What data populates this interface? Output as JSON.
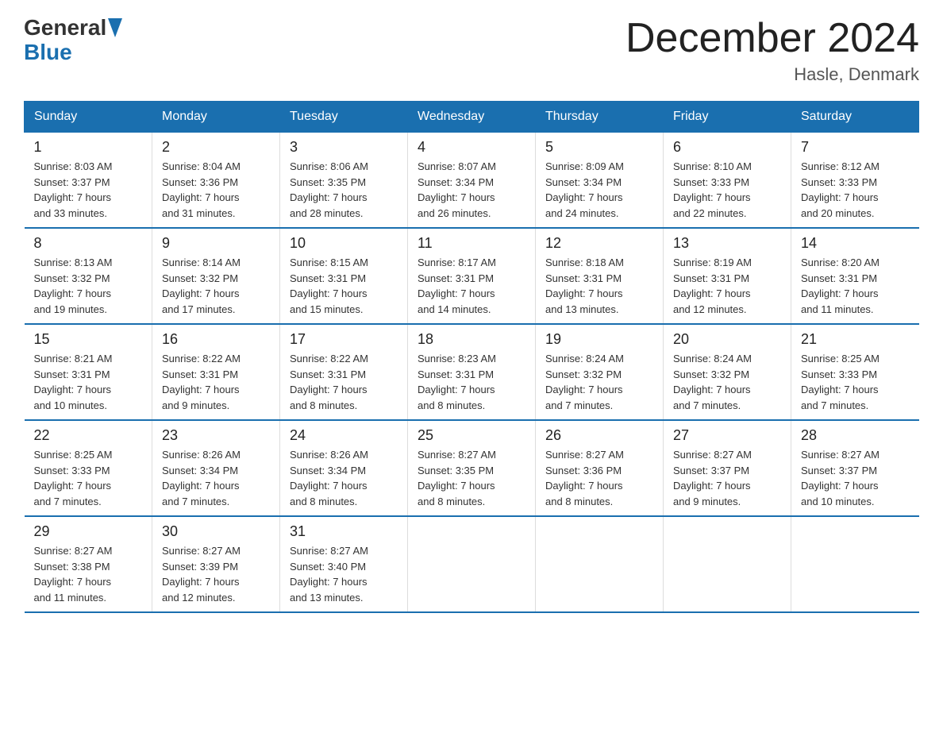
{
  "logo": {
    "general": "General",
    "blue": "Blue"
  },
  "title": {
    "month_year": "December 2024",
    "location": "Hasle, Denmark"
  },
  "days_of_week": [
    "Sunday",
    "Monday",
    "Tuesday",
    "Wednesday",
    "Thursday",
    "Friday",
    "Saturday"
  ],
  "weeks": [
    [
      {
        "day": "1",
        "info": "Sunrise: 8:03 AM\nSunset: 3:37 PM\nDaylight: 7 hours\nand 33 minutes."
      },
      {
        "day": "2",
        "info": "Sunrise: 8:04 AM\nSunset: 3:36 PM\nDaylight: 7 hours\nand 31 minutes."
      },
      {
        "day": "3",
        "info": "Sunrise: 8:06 AM\nSunset: 3:35 PM\nDaylight: 7 hours\nand 28 minutes."
      },
      {
        "day": "4",
        "info": "Sunrise: 8:07 AM\nSunset: 3:34 PM\nDaylight: 7 hours\nand 26 minutes."
      },
      {
        "day": "5",
        "info": "Sunrise: 8:09 AM\nSunset: 3:34 PM\nDaylight: 7 hours\nand 24 minutes."
      },
      {
        "day": "6",
        "info": "Sunrise: 8:10 AM\nSunset: 3:33 PM\nDaylight: 7 hours\nand 22 minutes."
      },
      {
        "day": "7",
        "info": "Sunrise: 8:12 AM\nSunset: 3:33 PM\nDaylight: 7 hours\nand 20 minutes."
      }
    ],
    [
      {
        "day": "8",
        "info": "Sunrise: 8:13 AM\nSunset: 3:32 PM\nDaylight: 7 hours\nand 19 minutes."
      },
      {
        "day": "9",
        "info": "Sunrise: 8:14 AM\nSunset: 3:32 PM\nDaylight: 7 hours\nand 17 minutes."
      },
      {
        "day": "10",
        "info": "Sunrise: 8:15 AM\nSunset: 3:31 PM\nDaylight: 7 hours\nand 15 minutes."
      },
      {
        "day": "11",
        "info": "Sunrise: 8:17 AM\nSunset: 3:31 PM\nDaylight: 7 hours\nand 14 minutes."
      },
      {
        "day": "12",
        "info": "Sunrise: 8:18 AM\nSunset: 3:31 PM\nDaylight: 7 hours\nand 13 minutes."
      },
      {
        "day": "13",
        "info": "Sunrise: 8:19 AM\nSunset: 3:31 PM\nDaylight: 7 hours\nand 12 minutes."
      },
      {
        "day": "14",
        "info": "Sunrise: 8:20 AM\nSunset: 3:31 PM\nDaylight: 7 hours\nand 11 minutes."
      }
    ],
    [
      {
        "day": "15",
        "info": "Sunrise: 8:21 AM\nSunset: 3:31 PM\nDaylight: 7 hours\nand 10 minutes."
      },
      {
        "day": "16",
        "info": "Sunrise: 8:22 AM\nSunset: 3:31 PM\nDaylight: 7 hours\nand 9 minutes."
      },
      {
        "day": "17",
        "info": "Sunrise: 8:22 AM\nSunset: 3:31 PM\nDaylight: 7 hours\nand 8 minutes."
      },
      {
        "day": "18",
        "info": "Sunrise: 8:23 AM\nSunset: 3:31 PM\nDaylight: 7 hours\nand 8 minutes."
      },
      {
        "day": "19",
        "info": "Sunrise: 8:24 AM\nSunset: 3:32 PM\nDaylight: 7 hours\nand 7 minutes."
      },
      {
        "day": "20",
        "info": "Sunrise: 8:24 AM\nSunset: 3:32 PM\nDaylight: 7 hours\nand 7 minutes."
      },
      {
        "day": "21",
        "info": "Sunrise: 8:25 AM\nSunset: 3:33 PM\nDaylight: 7 hours\nand 7 minutes."
      }
    ],
    [
      {
        "day": "22",
        "info": "Sunrise: 8:25 AM\nSunset: 3:33 PM\nDaylight: 7 hours\nand 7 minutes."
      },
      {
        "day": "23",
        "info": "Sunrise: 8:26 AM\nSunset: 3:34 PM\nDaylight: 7 hours\nand 7 minutes."
      },
      {
        "day": "24",
        "info": "Sunrise: 8:26 AM\nSunset: 3:34 PM\nDaylight: 7 hours\nand 8 minutes."
      },
      {
        "day": "25",
        "info": "Sunrise: 8:27 AM\nSunset: 3:35 PM\nDaylight: 7 hours\nand 8 minutes."
      },
      {
        "day": "26",
        "info": "Sunrise: 8:27 AM\nSunset: 3:36 PM\nDaylight: 7 hours\nand 8 minutes."
      },
      {
        "day": "27",
        "info": "Sunrise: 8:27 AM\nSunset: 3:37 PM\nDaylight: 7 hours\nand 9 minutes."
      },
      {
        "day": "28",
        "info": "Sunrise: 8:27 AM\nSunset: 3:37 PM\nDaylight: 7 hours\nand 10 minutes."
      }
    ],
    [
      {
        "day": "29",
        "info": "Sunrise: 8:27 AM\nSunset: 3:38 PM\nDaylight: 7 hours\nand 11 minutes."
      },
      {
        "day": "30",
        "info": "Sunrise: 8:27 AM\nSunset: 3:39 PM\nDaylight: 7 hours\nand 12 minutes."
      },
      {
        "day": "31",
        "info": "Sunrise: 8:27 AM\nSunset: 3:40 PM\nDaylight: 7 hours\nand 13 minutes."
      },
      null,
      null,
      null,
      null
    ]
  ]
}
